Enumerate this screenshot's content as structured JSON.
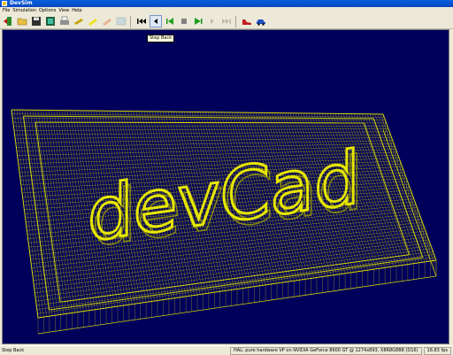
{
  "window": {
    "title": "DevSim"
  },
  "menu": [
    "File",
    "Simulation",
    "Options",
    "View",
    "Help"
  ],
  "toolbar": {
    "buttons": [
      {
        "name": "exit-icon"
      },
      {
        "name": "open-icon"
      },
      {
        "name": "save-icon"
      },
      {
        "name": "load-part-icon"
      },
      {
        "name": "print-icon"
      },
      {
        "name": "tool-icon"
      },
      {
        "name": "tool-yellow-icon"
      },
      {
        "name": "tool-orange-icon"
      },
      {
        "name": "view-icon"
      },
      {
        "name": "rewind-icon"
      },
      {
        "name": "step-back-icon"
      },
      {
        "name": "play-back-icon"
      },
      {
        "name": "stop-icon"
      },
      {
        "name": "play-icon"
      },
      {
        "name": "step-forward-icon"
      },
      {
        "name": "fast-forward-icon"
      },
      {
        "name": "shoe-icon"
      },
      {
        "name": "car-icon"
      }
    ]
  },
  "tooltip": {
    "text": "Step Back"
  },
  "scene": {
    "background": "#00005a",
    "mesh_color": "#e6e600",
    "text": "devCad"
  },
  "status": {
    "left": "Step Back",
    "renderer": "HAL: pure hardware VP on NVIDIA GeForce 8600 GT @ 1274x893, X8R8G8B8 (D16)",
    "fps": "18.83 fps"
  }
}
